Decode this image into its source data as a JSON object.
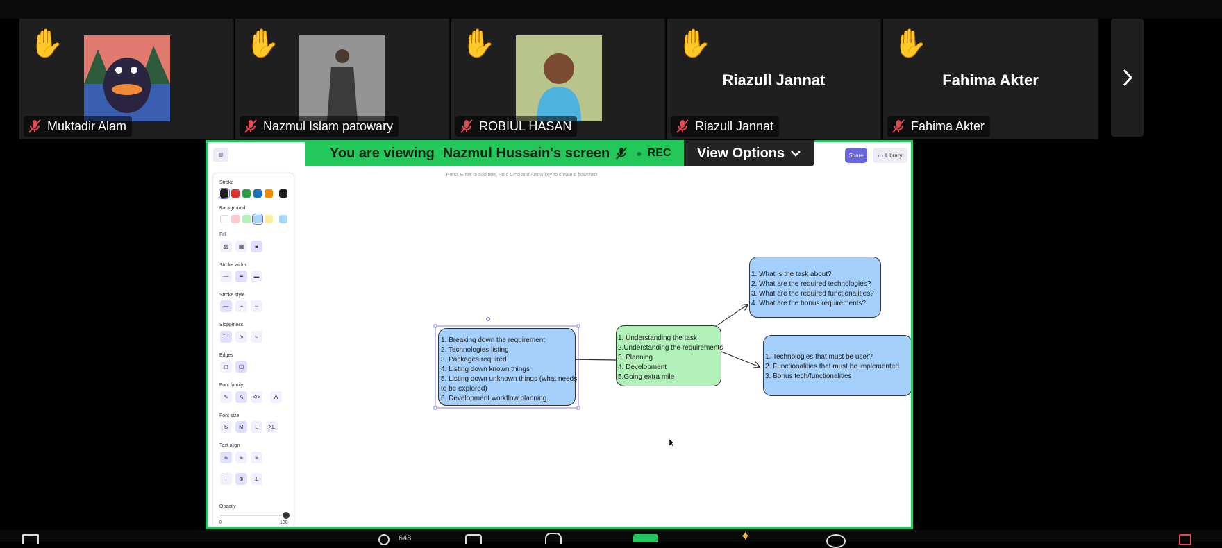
{
  "participants": [
    {
      "name": "Muktadir Alam",
      "hand": "✋",
      "video": "photo"
    },
    {
      "name": "Nazmul Islam patowary",
      "hand": "✋",
      "video": "photo"
    },
    {
      "name": "ROBIUL HASAN",
      "hand": "✋",
      "video": "photo"
    },
    {
      "name": "Riazull Jannat",
      "hand": "✋",
      "video": "name",
      "display_name": "Riazull Jannat"
    },
    {
      "name": "Fahima Akter",
      "hand": "✋",
      "video": "name",
      "display_name": "Fahima Akter"
    }
  ],
  "share_banner": {
    "prefix": "You are viewing",
    "presenter": "Nazmul Hussain's screen",
    "rec": "REC",
    "view_options": "View Options"
  },
  "excalidraw": {
    "top": {
      "share": "Share",
      "library": "Library"
    },
    "hint": "Press Enter to add text, Hold Cmd and Arrow key to create a flowchart",
    "panel": {
      "stroke": "Stroke",
      "background": "Background",
      "fill": "Fill",
      "stroke_width": "Stroke width",
      "stroke_style": "Stroke style",
      "sloppiness": "Sloppiness",
      "edges": "Edges",
      "font_family": "Font family",
      "font_size": "Font size",
      "font_sizes": [
        "S",
        "M",
        "L",
        "XL"
      ],
      "text_align": "Text align",
      "opacity": "Opacity",
      "opacity_min": "0",
      "opacity_max": "100",
      "opacity_value": 100
    },
    "colors": {
      "stroke": [
        "#1e1e1e",
        "#e03131",
        "#2f9e44",
        "#1971c2",
        "#f08c00"
      ],
      "stroke_current": "#1e1e1e",
      "background": [
        "#ffffff",
        "#ffc9c9",
        "#b2f2bb",
        "#a5d8ff",
        "#ffec99"
      ],
      "background_current": "#a5d8ff",
      "accent": "#6965db",
      "banner_green": "#22c85a"
    },
    "nodes": {
      "center": [
        "1. Understanding the task",
        "2.Understanding the requirements",
        "3. Planning",
        "4. Development",
        "5.Going extra mile"
      ],
      "left": [
        "1. Breaking down the requirement",
        "2. Technologies listing",
        "3. Packages required",
        "4. Listing down known things",
        "5. Listing down unknown things (what needs",
        "to be explored)",
        "6. Development workflow planning."
      ],
      "top_right": [
        "1. What is the task about?",
        "2. What are the required technologies?",
        "3. What are the required functionalities?",
        "4. What are the bonus requirements?"
      ],
      "bottom_right": [
        "1. Technologies that must be user?",
        "2. Functionalities that must be implemented",
        "3. Bonus tech/functionalities"
      ]
    }
  },
  "bottom_bar": {
    "participants_count": "648"
  }
}
